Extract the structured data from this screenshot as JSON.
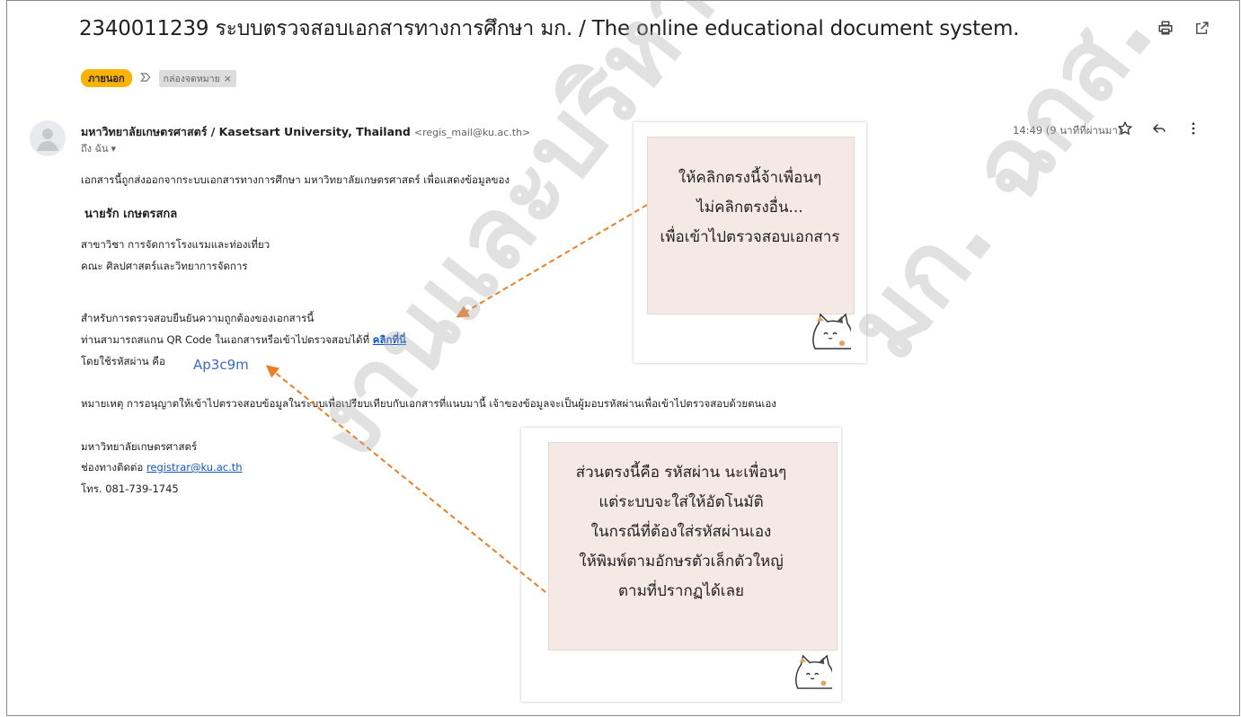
{
  "email": {
    "subject": "2340011239 ระบบตรวจสอบเอกสารทางการศึกษา มก. / The online educational document system.",
    "labels": {
      "external": "ภายนอก",
      "inbox": "กล่องจดหมาย",
      "remove": "×"
    },
    "sender_name": "มหาวิทยาลัยเกษตรศาสตร์ / Kasetsart University, Thailand",
    "sender_email": "<regis_mail@ku.ac.th>",
    "to_me": "ถึง ฉัน",
    "time": "14:49 (9 นาทีที่ผ่านมา)",
    "body": {
      "intro": "เอกสารนี้ถูกส่งออกจากระบบเอกสารทางการศึกษา มหาวิทยาลัยเกษตรศาสตร์ เพื่อแสดงข้อมูลของ",
      "name": "นายรัก เกษตรสกล",
      "major": "สาขาวิชา การจัดการโรงแรมและท่องเที่ยว",
      "faculty": "คณะ ศิลปศาสตร์และวิทยาการจัดการ",
      "verify": "สำหรับการตรวจสอบยืนยันความถูกต้องของเอกสารนี้",
      "scan_prefix": "ท่านสามารถสแกน QR Code ในเอกสารหรือเข้าไปตรวจสอบได้ที่ ",
      "click_here": "คลิกที่นี่",
      "password_label": "โดยใช้รหัสผ่าน คือ",
      "password": "Ap3c9m",
      "remark": "หมายเหตุ การอนุญาตให้เข้าไปตรวจสอบข้อมูลในระบบเพื่อเปรียบเทียบกับเอกสารที่แนบมานี้ เจ้าของข้อมูลจะเป็นผู้มอบรหัสผ่านเพื่อเข้าไปตรวจสอบด้วยตนเอง",
      "university": "มหาวิทยาลัยเกษตรศาสตร์",
      "contact_prefix": "ช่องทางติดต่อ ",
      "contact_email": "registrar@ku.ac.th",
      "phone": "โทร. 081-739-1745"
    }
  },
  "notes": {
    "top": [
      "ให้คลิกตรงนี้จ้าเพื่อนๆ",
      "ไม่คลิกตรงอื่น...",
      "เพื่อเข้าไปตรวจสอบเอกสาร"
    ],
    "bottom": [
      "ส่วนตรงนี้คือ รหัสผ่าน นะเพื่อนๆ",
      "แต่ระบบจะใส่ให้อัตโนมัติ",
      "ในกรณีที่ต้องใส่รหัสผ่านเอง",
      "ให้พิมพ์ตามอักษรตัวเล็กตัวใหญ่",
      "ตามที่ปรากฏได้เลย"
    ]
  },
  "watermark": {
    "line1": "งานและบริหารดูแลบุคคล",
    "line2": "มก. ฉกส."
  },
  "icons": [
    "print-icon",
    "open-in-new-icon",
    "star-icon",
    "reply-icon",
    "more-vert-icon",
    "label-arrow-icon",
    "avatar-icon",
    "cat-sticker-icon"
  ],
  "colors": {
    "external_badge": "#f9b300",
    "link": "#1155cc",
    "arrow": "#ef7d22",
    "note_bg": "#f5e9e6",
    "password": "#3b6bc9"
  }
}
